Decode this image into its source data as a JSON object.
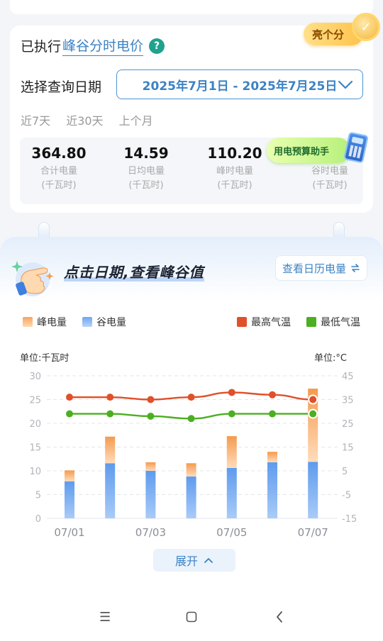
{
  "header": {
    "scheme_prefix": "已执行",
    "scheme_link": "峰谷分时电价",
    "help_icon": "?",
    "badge_label": "亮个分",
    "date_label": "选择查询日期",
    "date_range": "2025年7月1日 - 2025年7月25日",
    "quick_options": [
      "近7天",
      "近30天",
      "上个月"
    ]
  },
  "stats": [
    {
      "value": "364.80",
      "label": "合计电量",
      "unit": "(千瓦时)"
    },
    {
      "value": "14.59",
      "label": "日均电量",
      "unit": "(千瓦时)"
    },
    {
      "value": "110.20",
      "label": "峰时电量",
      "unit": "(千瓦时)"
    },
    {
      "value": "",
      "label": "谷时电量",
      "unit": "(千瓦时)"
    }
  ],
  "helper_label": "用电预算助手",
  "banner": {
    "title": "点击日期,查看峰谷值",
    "calendar_button": "查看日历电量"
  },
  "legend": {
    "peak": "峰电量",
    "valley": "谷电量",
    "max_temp": "最高气温",
    "min_temp": "最低气温"
  },
  "units": {
    "left": "单位:千瓦时",
    "right": "单位:°C"
  },
  "expand_label": "展开",
  "colors": {
    "accent": "#3b82c4",
    "peak": "#f6a55f",
    "valley": "#6fa6ef",
    "max_temp": "#e0502a",
    "min_temp": "#4caf22"
  },
  "chart_data": {
    "type": "bar",
    "categories": [
      "07/01",
      "07/02",
      "07/03",
      "07/04",
      "07/05",
      "07/06",
      "07/07"
    ],
    "x_tick_labels": [
      "07/01",
      "07/03",
      "07/05",
      "07/07"
    ],
    "left_ticks": [
      "0",
      "5",
      "10",
      "15",
      "20",
      "25",
      "30"
    ],
    "right_ticks": [
      "-15",
      "-5",
      "5",
      "15",
      "25",
      "35",
      "45"
    ],
    "ylim": [
      0,
      30
    ],
    "y2lim": [
      -15,
      45
    ],
    "series": [
      {
        "name": "谷电量",
        "type": "bar",
        "stack": "total",
        "values": [
          7.8,
          11.6,
          10.0,
          8.8,
          10.6,
          11.8,
          11.9
        ]
      },
      {
        "name": "峰电量",
        "type": "bar",
        "stack": "total",
        "values": [
          2.3,
          5.6,
          1.8,
          2.8,
          6.7,
          2.2,
          15.4
        ]
      },
      {
        "name": "最高气温",
        "type": "line",
        "axis": "right",
        "values": [
          36,
          36,
          35,
          36,
          38,
          37,
          35
        ]
      },
      {
        "name": "最低气温",
        "type": "line",
        "axis": "right",
        "values": [
          29,
          29,
          28,
          27,
          29,
          29,
          29
        ]
      }
    ]
  }
}
